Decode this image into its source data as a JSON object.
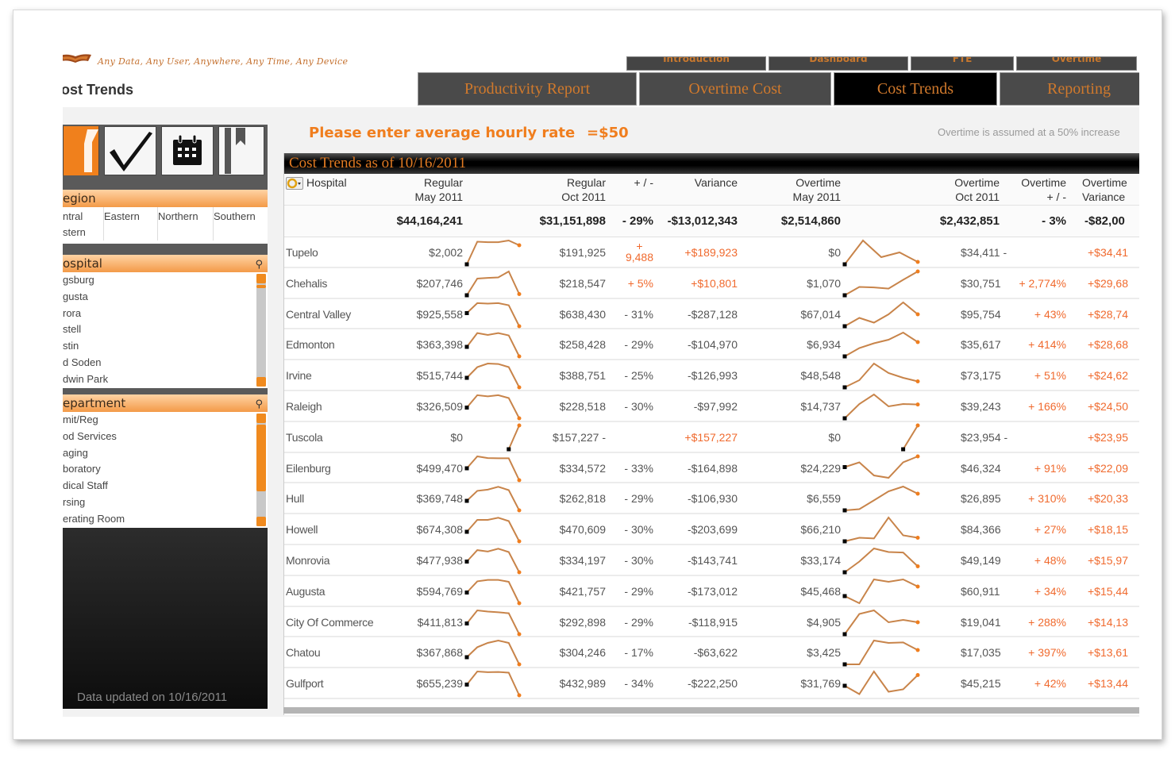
{
  "header": {
    "tagline": "Any Data, Any User, Anywhere, Any Time, Any Device",
    "page_title": "ost Trends",
    "top_tabs": [
      "Introduction",
      "Dashboard",
      "FTE",
      "Overtime"
    ],
    "tabs": [
      {
        "label": "Productivity Report",
        "active": false
      },
      {
        "label": "Overtime Cost",
        "active": false
      },
      {
        "label": "Cost Trends",
        "active": true
      },
      {
        "label": "Reporting",
        "active": false
      }
    ]
  },
  "colors": {
    "accent": "#f07e1e",
    "positive": "#f06a2e",
    "sparkline": "#c8844a",
    "tab_text": "#d0792c"
  },
  "sidebar": {
    "toolbar_icons": [
      "logo-tile-icon",
      "check-icon",
      "calendar-icon",
      "bookmark-icon"
    ],
    "region": {
      "title": "egion",
      "values": [
        [
          "ntral",
          "stern"
        ],
        [
          "Eastern"
        ],
        [
          "Northern"
        ],
        [
          "Southern"
        ]
      ]
    },
    "hospital": {
      "title": "ospital",
      "items": [
        "gsburg",
        "gusta",
        "rora",
        "stell",
        "stin",
        "d Soden",
        "dwin Park"
      ]
    },
    "department": {
      "title": "epartment",
      "items": [
        "mit/Reg",
        "od Services",
        "aging",
        "boratory",
        "dical Staff",
        "rsing",
        "erating Room"
      ]
    },
    "updated": "Data updated on 10/16/2011"
  },
  "main": {
    "rate_label": "Please enter average hourly rate",
    "rate_value": "=$50",
    "overtime_note": "Overtime is assumed at a 50% increase",
    "table_title": "Cost Trends as of 10/16/2011",
    "columns": {
      "hospital": "Hospital",
      "reg_may": "Regular\nMay 2011",
      "reg_oct": "Regular\nOct 2011",
      "reg_pct": "+ / -",
      "reg_var": "Variance",
      "ot_may": "Overtime\nMay 2011",
      "ot_oct": "Overtime\nOct 2011",
      "ot_pct": "Overtime\n+ / -",
      "ot_var": "Overtime\nVariance"
    },
    "totals": {
      "reg_may": "$44,164,241",
      "reg_oct": "$31,151,898",
      "reg_pct": "- 29%",
      "reg_var": "-$13,012,343",
      "ot_may": "$2,514,860",
      "ot_oct": "$2,432,851",
      "ot_pct": "- 3%",
      "ot_var": "-$82,00"
    },
    "rows": [
      {
        "hospital": "Tupelo",
        "reg_may": "$2,002",
        "reg_oct": "$191,925",
        "reg_pct": "+\n9,488",
        "reg_var": "+$189,923",
        "ot_may": "$0",
        "ot_oct": "$34,411 -",
        "ot_pct": "",
        "ot_var": "+$34,41",
        "reg_pos": true,
        "reg_spark": [
          0.0,
          0.95,
          0.93,
          0.93,
          1.0,
          0.8
        ],
        "ot_spark": [
          0.0,
          1.0,
          0.3,
          0.5,
          0.1
        ]
      },
      {
        "hospital": "Chehalis",
        "reg_may": "$207,746",
        "reg_oct": "$218,547",
        "reg_pct": "+ 5%",
        "reg_var": "+$10,801",
        "ot_may": "$1,070",
        "ot_oct": "$30,751",
        "ot_pct": "+ 2,774%",
        "ot_var": "+$29,68",
        "reg_pos": true,
        "reg_spark": [
          0.0,
          0.7,
          0.73,
          0.75,
          1.0,
          0.05
        ],
        "ot_spark": [
          0.0,
          0.35,
          0.33,
          0.28,
          0.65,
          1.0
        ]
      },
      {
        "hospital": "Central Valley",
        "reg_may": "$925,558",
        "reg_oct": "$638,430",
        "reg_pct": "- 31%",
        "reg_var": "-$287,128",
        "ot_may": "$67,014",
        "ot_oct": "$95,754",
        "ot_pct": "+ 43%",
        "ot_var": "+$28,74",
        "reg_pos": false,
        "reg_spark": [
          0.55,
          0.97,
          0.95,
          0.97,
          0.88,
          0.0
        ],
        "ot_spark": [
          0.0,
          0.35,
          0.15,
          0.5,
          1.0,
          0.5
        ]
      },
      {
        "hospital": "Edmonton",
        "reg_may": "$363,398",
        "reg_oct": "$258,428",
        "reg_pct": "- 29%",
        "reg_var": "-$104,970",
        "ot_may": "$6,934",
        "ot_oct": "$35,617",
        "ot_pct": "+ 414%",
        "ot_var": "+$28,68",
        "reg_pos": false,
        "reg_spark": [
          0.4,
          0.98,
          0.9,
          0.98,
          0.88,
          0.0
        ],
        "ot_spark": [
          0.0,
          0.35,
          0.55,
          0.7,
          1.0,
          0.6
        ]
      },
      {
        "hospital": "Irvine",
        "reg_may": "$515,744",
        "reg_oct": "$388,751",
        "reg_pct": "- 25%",
        "reg_var": "-$126,993",
        "ot_may": "$48,548",
        "ot_oct": "$73,175",
        "ot_pct": "+ 51%",
        "ot_var": "+$24,62",
        "reg_pos": false,
        "reg_spark": [
          0.4,
          0.85,
          1.0,
          0.98,
          0.85,
          0.0
        ],
        "ot_spark": [
          0.0,
          0.3,
          1.0,
          0.6,
          0.4,
          0.25
        ]
      },
      {
        "hospital": "Raleigh",
        "reg_may": "$326,509",
        "reg_oct": "$228,518",
        "reg_pct": "- 30%",
        "reg_var": "-$97,992",
        "ot_may": "$14,737",
        "ot_oct": "$39,243",
        "ot_pct": "+ 166%",
        "ot_var": "+$24,50",
        "reg_pos": false,
        "reg_spark": [
          0.45,
          0.97,
          0.92,
          0.97,
          0.85,
          0.0
        ],
        "ot_spark": [
          0.0,
          0.6,
          1.0,
          0.5,
          0.6,
          0.58
        ]
      },
      {
        "hospital": "Tuscola",
        "reg_may": "$0",
        "reg_oct": "$157,227 -",
        "reg_pct": "",
        "reg_var": "+$157,227",
        "ot_may": "$0",
        "ot_oct": "$23,954 -",
        "ot_pct": "",
        "ot_var": "+$23,95",
        "reg_pos": true,
        "reg_var_pos": true,
        "reg_spark": [
          null,
          null,
          null,
          null,
          0.0,
          1.0
        ],
        "ot_spark": [
          null,
          null,
          null,
          null,
          0.0,
          1.0
        ]
      },
      {
        "hospital": "Eilenburg",
        "reg_may": "$499,470",
        "reg_oct": "$334,572",
        "reg_pct": "- 33%",
        "reg_var": "-$164,898",
        "ot_may": "$24,229",
        "ot_oct": "$46,324",
        "ot_pct": "+ 91%",
        "ot_var": "+$22,09",
        "reg_pos": false,
        "reg_spark": [
          0.5,
          1.0,
          0.93,
          0.92,
          0.92,
          0.0
        ],
        "ot_spark": [
          0.55,
          0.75,
          0.2,
          0.1,
          0.75,
          1.0
        ]
      },
      {
        "hospital": "Hull",
        "reg_may": "$369,748",
        "reg_oct": "$262,818",
        "reg_pct": "- 29%",
        "reg_var": "-$106,930",
        "ot_may": "$6,559",
        "ot_oct": "$26,895",
        "ot_pct": "+ 310%",
        "ot_var": "+$20,33",
        "reg_pos": false,
        "reg_spark": [
          0.4,
          0.82,
          0.87,
          0.99,
          0.85,
          0.0
        ],
        "ot_spark": [
          0.0,
          0.05,
          0.42,
          0.8,
          1.0,
          0.7
        ]
      },
      {
        "hospital": "Howell",
        "reg_may": "$674,308",
        "reg_oct": "$470,609",
        "reg_pct": "- 30%",
        "reg_var": "-$203,699",
        "ot_may": "$66,210",
        "ot_oct": "$84,366",
        "ot_pct": "+ 27%",
        "ot_var": "+$18,15",
        "reg_pos": false,
        "reg_spark": [
          0.4,
          0.9,
          0.9,
          0.99,
          0.85,
          0.0
        ],
        "ot_spark": [
          0.0,
          0.15,
          0.12,
          1.0,
          0.25,
          0.15
        ]
      },
      {
        "hospital": "Monrovia",
        "reg_may": "$477,938",
        "reg_oct": "$334,197",
        "reg_pct": "- 30%",
        "reg_var": "-$143,741",
        "ot_may": "$33,174",
        "ot_oct": "$49,149",
        "ot_pct": "+ 48%",
        "ot_var": "+$15,97",
        "reg_pos": false,
        "reg_spark": [
          0.45,
          0.93,
          0.87,
          0.99,
          0.85,
          0.0
        ],
        "ot_spark": [
          0.0,
          0.45,
          1.0,
          0.85,
          0.83,
          0.25
        ]
      },
      {
        "hospital": "Augusta",
        "reg_may": "$594,769",
        "reg_oct": "$421,757",
        "reg_pct": "- 29%",
        "reg_var": "-$173,012",
        "ot_may": "$45,468",
        "ot_oct": "$60,911",
        "ot_pct": "+ 34%",
        "ot_var": "+$15,44",
        "reg_pos": false,
        "reg_spark": [
          0.45,
          0.92,
          0.98,
          0.98,
          0.9,
          0.0
        ],
        "ot_spark": [
          0.3,
          0.0,
          1.0,
          0.9,
          1.0,
          0.7
        ]
      },
      {
        "hospital": "City Of Commerce",
        "reg_may": "$411,813",
        "reg_oct": "$292,898",
        "reg_pct": "- 29%",
        "reg_var": "-$118,915",
        "ot_may": "$4,905",
        "ot_oct": "$19,041",
        "ot_pct": "+ 288%",
        "ot_var": "+$14,13",
        "reg_pos": false,
        "reg_spark": [
          0.45,
          1.0,
          0.95,
          0.92,
          0.88,
          0.0
        ],
        "ot_spark": [
          0.0,
          0.85,
          1.0,
          0.5,
          0.6,
          0.5
        ]
      },
      {
        "hospital": "Chatou",
        "reg_may": "$367,868",
        "reg_oct": "$304,246",
        "reg_pct": "- 17%",
        "reg_var": "-$63,622",
        "ot_may": "$3,425",
        "ot_oct": "$17,035",
        "ot_pct": "+ 397%",
        "ot_var": "+$13,61",
        "reg_pos": false,
        "reg_spark": [
          0.3,
          0.72,
          0.9,
          1.0,
          0.9,
          0.0
        ],
        "ot_spark": [
          0.0,
          0.0,
          1.0,
          0.9,
          0.92,
          0.6
        ]
      },
      {
        "hospital": "Gulfport",
        "reg_may": "$655,239",
        "reg_oct": "$432,989",
        "reg_pct": "- 34%",
        "reg_var": "-$222,250",
        "ot_may": "$31,769",
        "ot_oct": "$45,215",
        "ot_pct": "+ 42%",
        "ot_var": "+$13,44",
        "reg_pos": false,
        "reg_spark": [
          0.45,
          1.0,
          0.97,
          0.98,
          0.95,
          0.0
        ],
        "ot_spark": [
          0.4,
          0.05,
          1.0,
          0.15,
          0.25,
          0.85
        ]
      }
    ]
  }
}
